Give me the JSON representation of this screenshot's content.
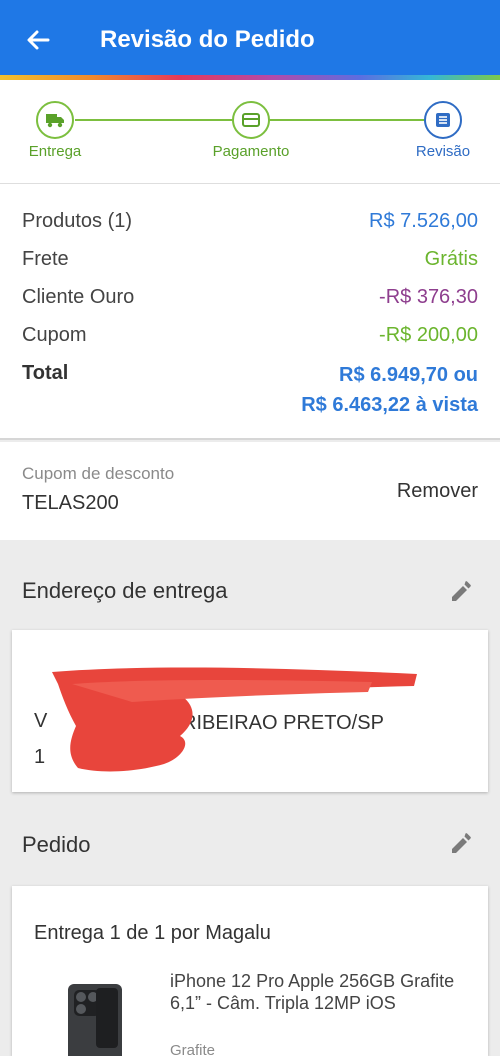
{
  "appbar": {
    "title": "Revisão do Pedido",
    "back_icon": "arrow-left-icon",
    "accent": "#1f78e6"
  },
  "steps": [
    {
      "label": "Entrega",
      "icon": "truck-icon",
      "state": "done"
    },
    {
      "label": "Pagamento",
      "icon": "credit-card-icon",
      "state": "done"
    },
    {
      "label": "Revisão",
      "icon": "list-icon",
      "state": "active"
    }
  ],
  "summary": {
    "products_label": "Produtos (1)",
    "products_value": "R$ 7.526,00",
    "shipping_label": "Frete",
    "shipping_value": "Grátis",
    "gold_label": "Cliente Ouro",
    "gold_value": "-R$ 376,30",
    "coupon_label": "Cupom",
    "coupon_value": "-R$ 200,00",
    "total_label": "Total",
    "total_value_1": "R$ 6.949,70 ou",
    "total_value_2": "R$ 6.463,22 à vista"
  },
  "coupon": {
    "caption": "Cupom de desconto",
    "code": "TELAS200",
    "remove_label": "Remover"
  },
  "address": {
    "title": "Endereço de entrega",
    "city_line": "RIBEIRAO PRETO/SP",
    "line_prefix": "V",
    "line_last": "1"
  },
  "order": {
    "title": "Pedido",
    "delivery_title": "Entrega 1 de 1 por Magalu",
    "product_name": "iPhone 12 Pro Apple 256GB Grafite 6,1” - Câm. Tripla 12MP iOS",
    "product_color": "Grafite"
  }
}
